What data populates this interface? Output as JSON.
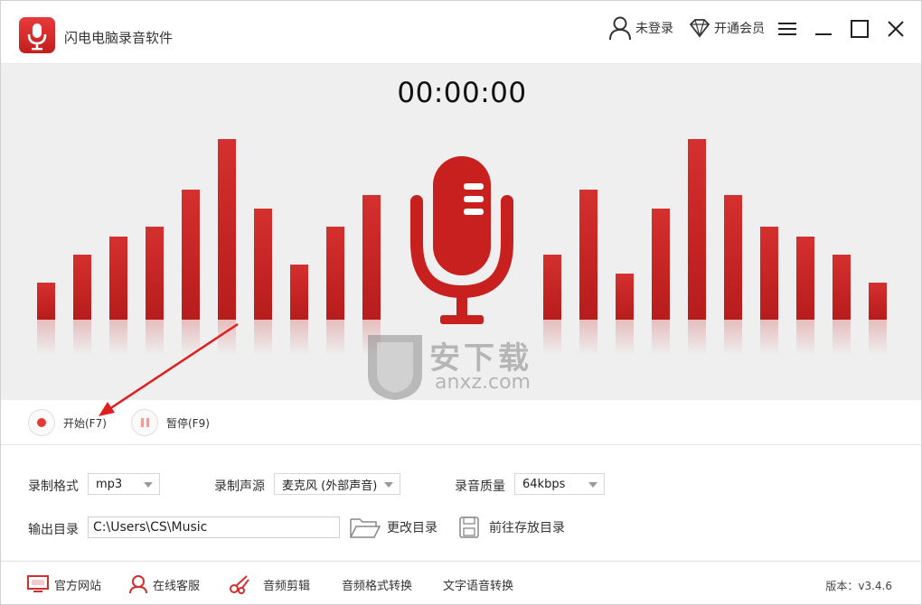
{
  "app": {
    "title": "闪电电脑录音软件"
  },
  "titlebar": {
    "user_label": "未登录",
    "vip_label": "开通会员",
    "icons": [
      "user-icon",
      "diamond-icon",
      "menu-icon",
      "minimize-icon",
      "maximize-icon",
      "close-icon"
    ]
  },
  "visualizer": {
    "timer": "00:00:00",
    "bar_levels": [
      0.205,
      0.36,
      0.46,
      0.515,
      0.72,
      1.0,
      0.615,
      0.305,
      0.515,
      0.69,
      0.0,
      0.0,
      0.0,
      0.0,
      0.36,
      0.72,
      0.255,
      0.615,
      1.0,
      0.69,
      0.515,
      0.46,
      0.36,
      0.205
    ]
  },
  "controls": {
    "start_label": "开始(F7)",
    "pause_label": "暂停(F9)"
  },
  "settings": {
    "format_label": "录制格式",
    "format_value": "mp3",
    "source_label": "录制声源",
    "source_value": "麦克风 (外部声音)",
    "quality_label": "录音质量",
    "quality_value": "64kbps",
    "output_label": "输出目录",
    "output_value": "C:\\Users\\CS\\Music",
    "change_dir_label": "更改目录",
    "open_dir_label": "前往存放目录"
  },
  "footer": {
    "items": [
      "官方网站",
      "在线客服",
      "音频剪辑",
      "音频格式转换",
      "文字语音转换"
    ],
    "version": "版本：v3.4.6"
  },
  "watermark": {
    "text": "安下载",
    "sub": "anxz.com"
  },
  "colors": {
    "accent": "#c62828",
    "background": "#efefef"
  }
}
